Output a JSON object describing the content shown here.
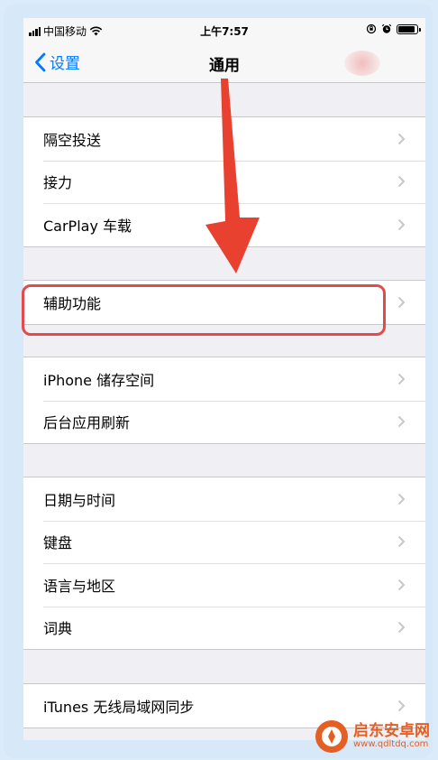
{
  "status_bar": {
    "carrier": "中国移动",
    "time": "上午7:57"
  },
  "nav": {
    "back_label": "设置",
    "title": "通用"
  },
  "groups": [
    {
      "rows": [
        "隔空投送",
        "接力",
        "CarPlay 车载"
      ]
    },
    {
      "rows": [
        "辅助功能"
      ]
    },
    {
      "rows": [
        "iPhone 储存空间",
        "后台应用刷新"
      ]
    },
    {
      "rows": [
        "日期与时间",
        "键盘",
        "语言与地区",
        "词典"
      ]
    },
    {
      "rows": [
        "iTunes 无线局域网同步"
      ]
    }
  ],
  "annotations": {
    "highlight_color": "#e24b4a",
    "arrow_color": "#e8412f",
    "highlighted_row": "辅助功能"
  },
  "watermark": {
    "name": "启东安卓网",
    "url": "www.qdltdq.com"
  },
  "icons": {
    "signal": "signal-bars-icon",
    "wifi": "wifi-icon",
    "orientation_lock": "orientation-lock-icon",
    "alarm": "alarm-icon",
    "battery": "battery-icon",
    "back": "chevron-left-icon",
    "disclosure": "chevron-right-icon",
    "arrow": "arrow-down-icon"
  }
}
